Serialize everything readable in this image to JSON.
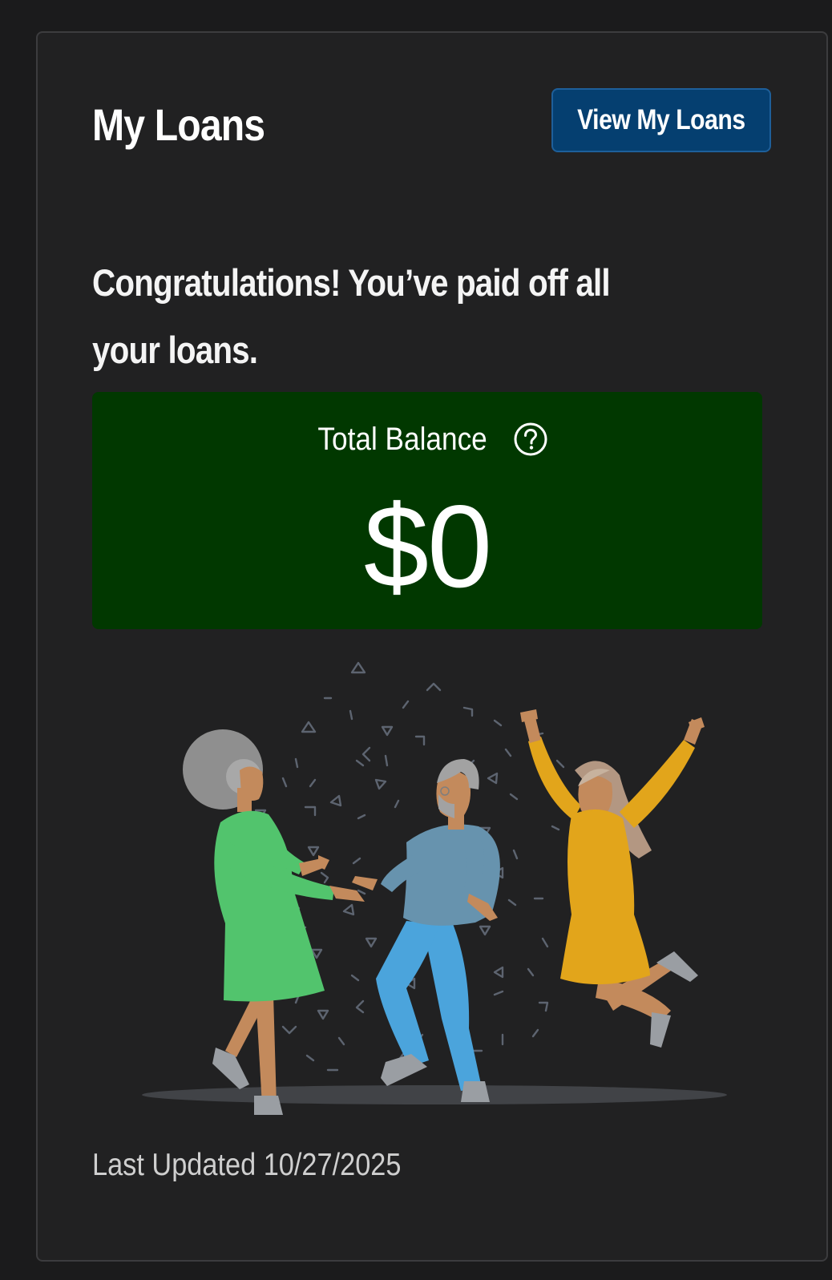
{
  "card": {
    "title": "My Loans",
    "view_button_label": "View My Loans",
    "congrats_message": "Congratulations! You’ve paid off all your loans.",
    "balance": {
      "label": "Total Balance",
      "amount": "$0",
      "help_icon": "question-circle-icon",
      "background_color": "#013800"
    },
    "illustration": "celebrating-people-illustration",
    "last_updated": "Last Updated 10/27/2025"
  },
  "colors": {
    "page_background": "#1b1b1c",
    "card_background": "#212122",
    "button_background": "#053f70",
    "balance_background": "#013800"
  }
}
